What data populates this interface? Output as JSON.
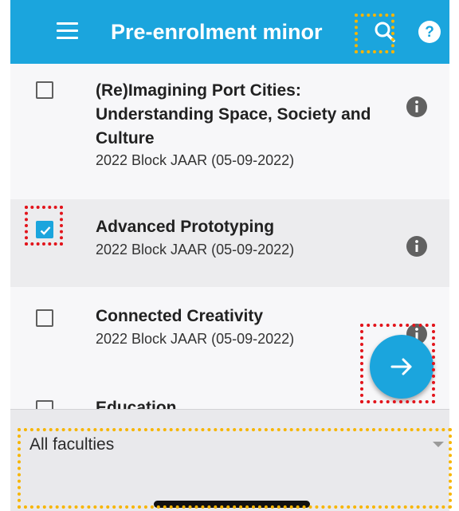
{
  "appbar": {
    "title": "Pre-enrolment minor",
    "menu_icon": "menu-icon",
    "search_icon": "search-icon",
    "help_icon": "help-icon",
    "color": "#1ba5dd"
  },
  "courses": [
    {
      "title": "(Re)Imagining Port Cities: Understanding Space, Society and Culture",
      "subtitle": "2022 Block JAAR (05-09-2022)",
      "checked": false
    },
    {
      "title": "Advanced Prototyping",
      "subtitle": "2022 Block JAAR (05-09-2022)",
      "checked": true
    },
    {
      "title": "Connected Creativity",
      "subtitle": "2022 Block JAAR (05-09-2022)",
      "checked": false
    },
    {
      "title": "Education",
      "subtitle": "",
      "checked": false
    }
  ],
  "fab": {
    "icon": "arrow-right-icon"
  },
  "filter": {
    "selected": "All faculties"
  },
  "highlight_colors": {
    "red": "#e2141b",
    "yellow": "#f7b500",
    "black": "#111111"
  }
}
